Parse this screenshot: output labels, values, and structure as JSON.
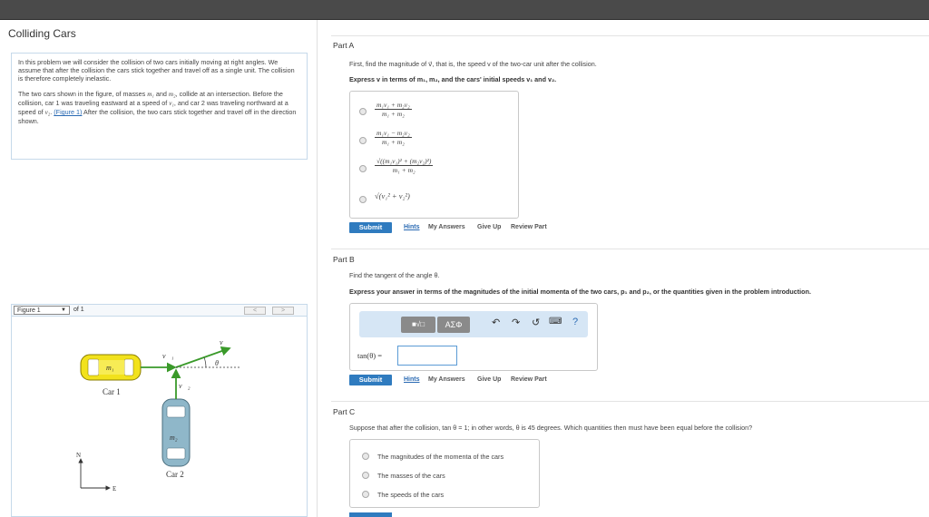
{
  "header": {
    "title": "Colliding Cars"
  },
  "intro": {
    "p1": "In this problem we will consider the collision of two cars initially moving at right angles. We assume that after the collision the cars stick together and travel off as a single unit. The collision is therefore completely inelastic.",
    "p2_a": "The two cars shown in the figure, of masses ",
    "p2_m1": "m₁",
    "p2_and": " and ",
    "p2_m2": "m₂",
    "p2_b": ", collide at an intersection. Before the collision, car 1 was traveling eastward at a speed of ",
    "p2_v1": "v₁",
    "p2_c": ", and car 2 was traveling northward at a speed of ",
    "p2_v2": "v₂",
    "p2_d": ". ",
    "p2_link": "(Figure 1)",
    "p2_e": " After the collision, the two cars stick together and travel off in the direction shown."
  },
  "figure": {
    "selector_label": "Figure 1",
    "of_label": "of 1",
    "prev": "<",
    "next": ">",
    "car1_label": "Car 1",
    "car2_label": "Car 2",
    "m1": "m₁",
    "m2": "m₂",
    "v1": "v⃗₁",
    "v2": "v⃗₂",
    "v": "v⃗",
    "theta": "θ",
    "compass_n": "N",
    "compass_e": "E",
    "colors": {
      "car1": "#f2e21c",
      "car2": "#8fb7c9",
      "arrow": "#3a9a2a"
    }
  },
  "partA": {
    "heading": "Part A",
    "question": "First, find the magnitude of v⃗, that is, the speed v of the two-car unit after the collision.",
    "instruction": "Express v in terms of m₁, m₂, and the cars' initial speeds v₁ and v₂.",
    "options": [
      {
        "num": "m₁v₁ + m₂v₂",
        "den": "m₁ + m₂"
      },
      {
        "num": "m₁v₁ − m₂v₂",
        "den": "m₁ + m₂"
      },
      {
        "num": "√((m₁v₁)² + (m₂v₂)²)",
        "den": "m₁ + m₂"
      },
      {
        "expr": "√(v₁² + v₂²)"
      }
    ]
  },
  "actions": {
    "submit": "Submit",
    "hints": "Hints",
    "my_answers": "My Answers",
    "give_up": "Give Up",
    "review_part": "Review Part"
  },
  "partB": {
    "heading": "Part B",
    "question": "Find the tangent of the angle θ.",
    "instruction": "Express your answer in terms of the magnitudes of the initial momenta of the two cars, p₁ and p₂, or the quantities given in the problem introduction.",
    "toolbar": {
      "templates": "■√□",
      "symbols": "AΣΦ",
      "undo": "↶",
      "redo": "↷",
      "reset": "↺",
      "keyboard": "⌨",
      "help": "?"
    },
    "answer_label": "tan(θ) =",
    "answer_value": ""
  },
  "partC": {
    "heading": "Part C",
    "question": "Suppose that after the collision, tan θ = 1; in other words, θ is 45 degrees. Which quantities then must have been equal before the collision?",
    "choices": [
      "The magnitudes of the momenta of the cars",
      "The masses of the cars",
      "The speeds of the cars"
    ]
  }
}
